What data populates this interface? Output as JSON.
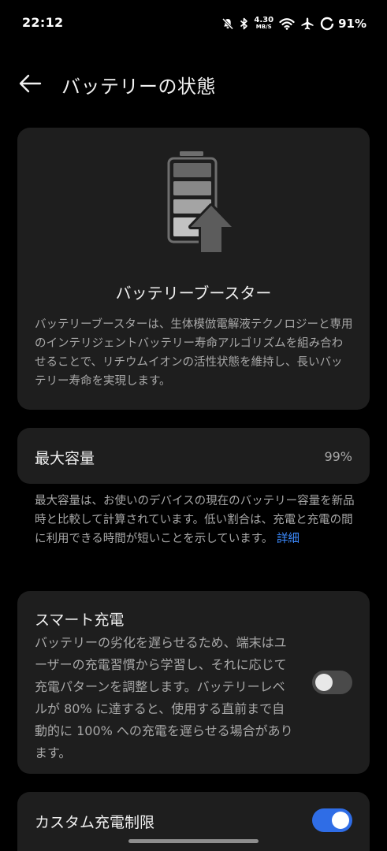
{
  "status_bar": {
    "time": "22:12",
    "net_speed_value": "4.30",
    "net_speed_unit": "MB/S",
    "battery_percent": "91%",
    "icons": [
      "mute-bell-icon",
      "bluetooth-icon",
      "wifi-icon",
      "airplane-icon",
      "battery-ring-icon"
    ]
  },
  "header": {
    "back_icon": "arrow-left-icon",
    "title": "バッテリーの状態"
  },
  "battery_booster": {
    "icon": "battery-booster-icon",
    "title": "バッテリーブースター",
    "description": "バッテリーブースターは、生体模倣電解液テクノロジーと専用のインテリジェントバッテリー寿命アルゴリズムを組み合わせることで、リチウムイオンの活性状態を維持し、長いバッテリー寿命を実現します。"
  },
  "max_capacity": {
    "label": "最大容量",
    "value": "99%",
    "note": "最大容量は、お使いのデバイスの現在のバッテリー容量を新品時と比較して計算されています。低い割合は、充電と充電の間に利用できる時間が短いことを示しています。",
    "link": "詳細"
  },
  "smart_charging": {
    "title": "スマート充電",
    "description": "バッテリーの劣化を遅らせるため、端末はユーザーの充電習慣から学習し、それに応じて充電パターンを調整します。バッテリーレベルが 80% に達すると、使用する直前まで自動的に 100% への充電を遅らせる場合があります。",
    "enabled": false
  },
  "custom_charge_limit": {
    "title": "カスタム充電制限",
    "enabled": true
  },
  "colors": {
    "background": "#000000",
    "card": "#1e1e1e",
    "accent": "#2f6de6",
    "link": "#3d8bff"
  }
}
